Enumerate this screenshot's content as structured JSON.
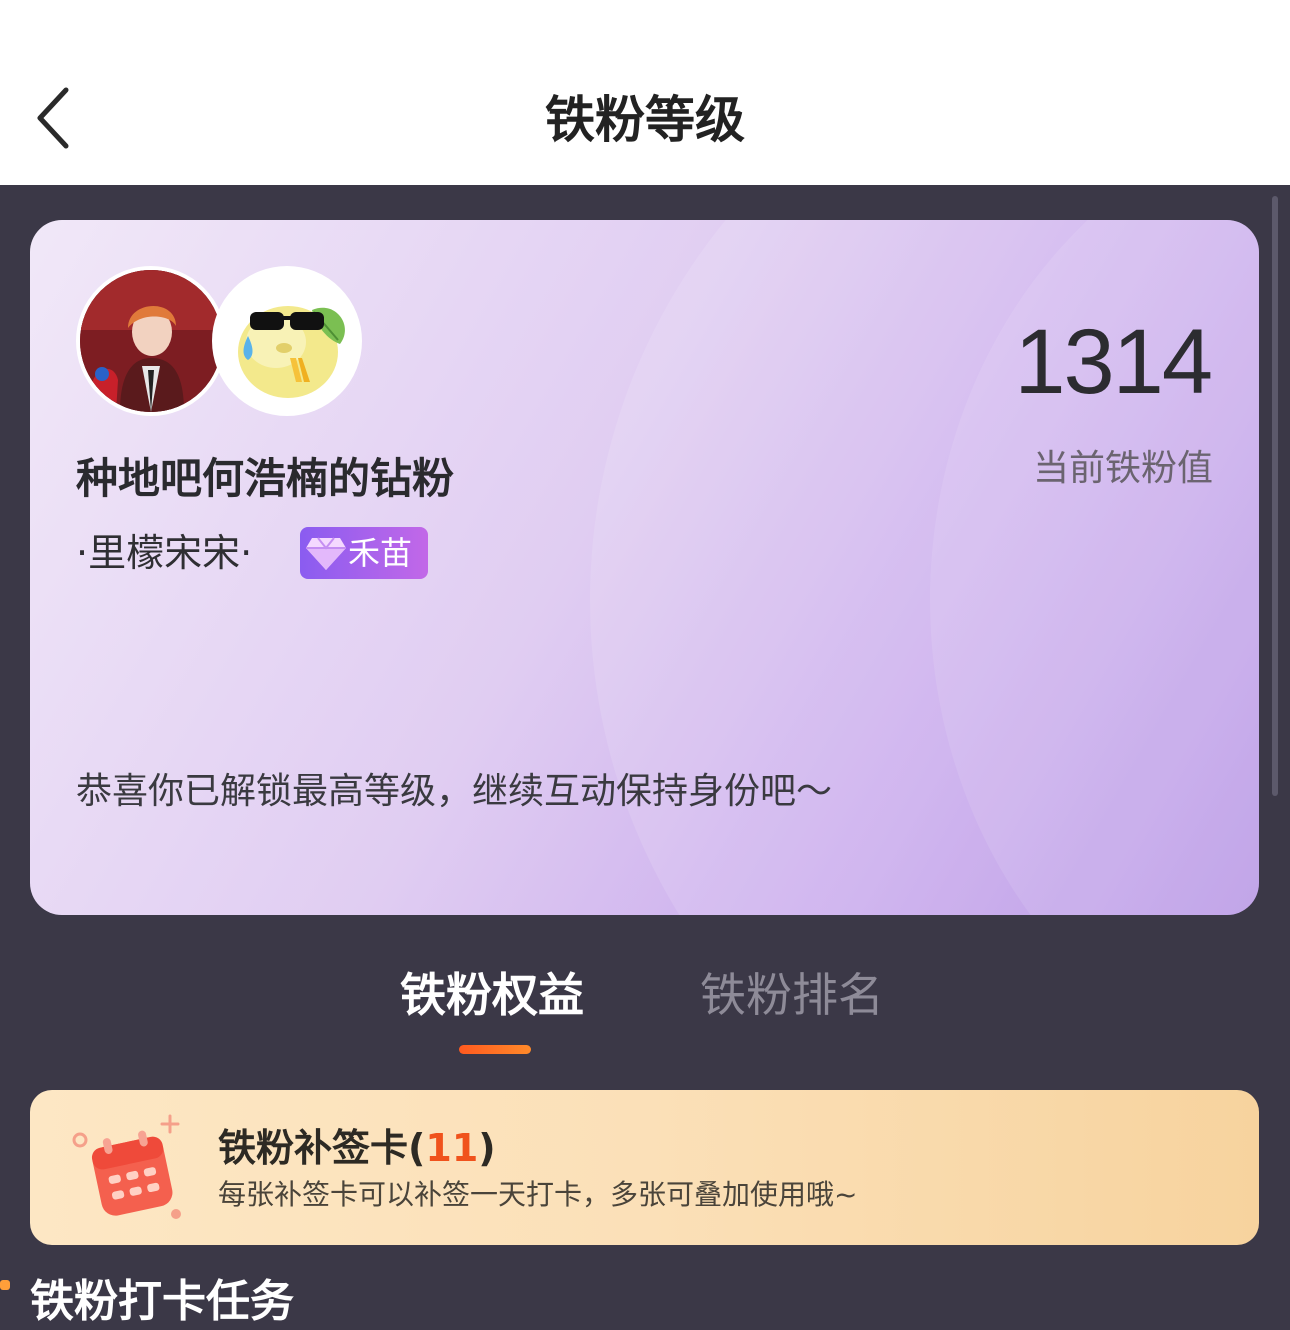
{
  "header": {
    "title": "铁粉等级",
    "back_icon": "chevron-left-icon"
  },
  "profile_card": {
    "idol_name": "种地吧何浩楠的钻粉",
    "user_name": "·里檬宋宋·",
    "level_badge": {
      "icon": "diamond-icon",
      "label": "禾苗"
    },
    "fan_value": "1314",
    "fan_value_label": "当前铁粉值",
    "congrats_text": "恭喜你已解锁最高等级，继续互动保持身份吧～"
  },
  "tabs": [
    {
      "label": "铁粉权益",
      "active": true
    },
    {
      "label": "铁粉排名",
      "active": false
    }
  ],
  "makeup_card": {
    "title": "铁粉补签卡",
    "count_open": "(",
    "count": "11",
    "count_close": ")",
    "description": "每张补签卡可以补签一天打卡，多张可叠加使用哦~",
    "icon": "calendar-icon"
  },
  "section": {
    "title": "铁粉打卡任务"
  },
  "colors": {
    "background": "#3b3847",
    "accent": "#ff5a1f",
    "badge": "#8a5cf0"
  }
}
